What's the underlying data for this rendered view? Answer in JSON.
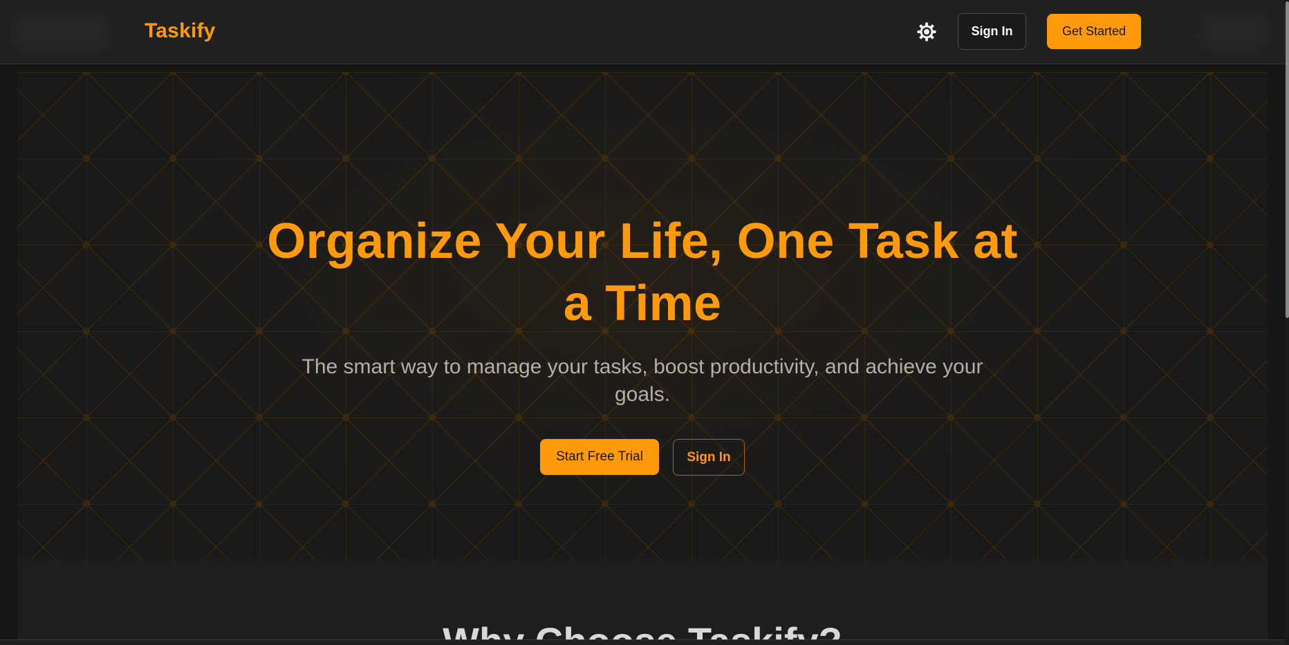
{
  "header": {
    "brand": "Taskify",
    "sign_in_label": "Sign In",
    "get_started_label": "Get Started",
    "theme_icon": "sun-icon"
  },
  "hero": {
    "title": "Organize Your Life, One Task at a Time",
    "subtitle": "The smart way to manage your tasks, boost productivity, and achieve your goals.",
    "primary_cta": "Start Free Trial",
    "secondary_cta": "Sign In"
  },
  "features": {
    "heading": "Why Choose Taskify?"
  },
  "colors": {
    "accent": "#ff9a0c",
    "background": "#161616",
    "header_bg": "#212121",
    "hero_bg": "#191919",
    "subtitle_text": "#b4b0a8",
    "grid_line": "#3d2a0d"
  }
}
